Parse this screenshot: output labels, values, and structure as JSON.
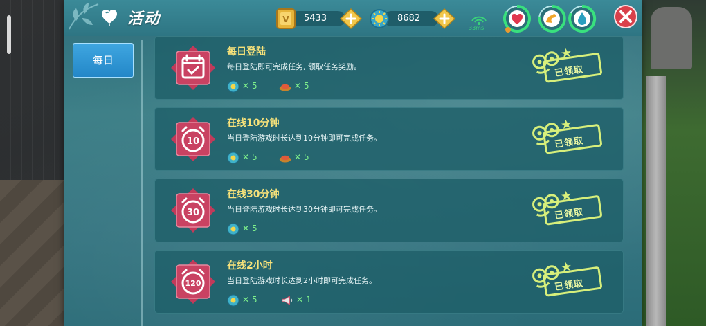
{
  "header": {
    "title": "活动",
    "gold_amount": "5433",
    "gem_amount": "8682",
    "ping": "33ms"
  },
  "sidebar": {
    "tabs": [
      {
        "label": "每日"
      }
    ]
  },
  "tasks": [
    {
      "name": "每日登陆",
      "desc": "每日登陆即可完成任务, 领取任务奖励。",
      "icon": "calendar-check-icon",
      "rewards": [
        {
          "icon": "gem-coin-icon",
          "x": "✕",
          "amount": "5"
        },
        {
          "icon": "food-plate-icon",
          "x": "✕",
          "amount": "5"
        }
      ],
      "status": "已领取"
    },
    {
      "name": "在线10分钟",
      "desc": "当日登陆游戏时长达到10分钟即可完成任务。",
      "icon": "alarm-clock-icon",
      "clock": "10",
      "rewards": [
        {
          "icon": "gem-coin-icon",
          "x": "✕",
          "amount": "5"
        },
        {
          "icon": "food-plate-icon",
          "x": "✕",
          "amount": "5"
        }
      ],
      "status": "已领取"
    },
    {
      "name": "在线30分钟",
      "desc": "当日登陆游戏时长达到30分钟即可完成任务。",
      "icon": "alarm-clock-icon",
      "clock": "30",
      "rewards": [
        {
          "icon": "gem-coin-icon",
          "x": "✕",
          "amount": "5"
        }
      ],
      "status": "已领取"
    },
    {
      "name": "在线2小时",
      "desc": "当日登陆游戏时长达到2小时即可完成任务。",
      "icon": "alarm-clock-icon",
      "clock": "120",
      "rewards": [
        {
          "icon": "gem-coin-icon",
          "x": "✕",
          "amount": "5"
        },
        {
          "icon": "horn-icon",
          "x": "✕",
          "amount": "1"
        }
      ],
      "status": "已领取"
    }
  ],
  "colors": {
    "panel": "#357581",
    "task_title": "#f7e27a",
    "reward_text": "#7ef08c",
    "tab_active": "#2387c8"
  }
}
